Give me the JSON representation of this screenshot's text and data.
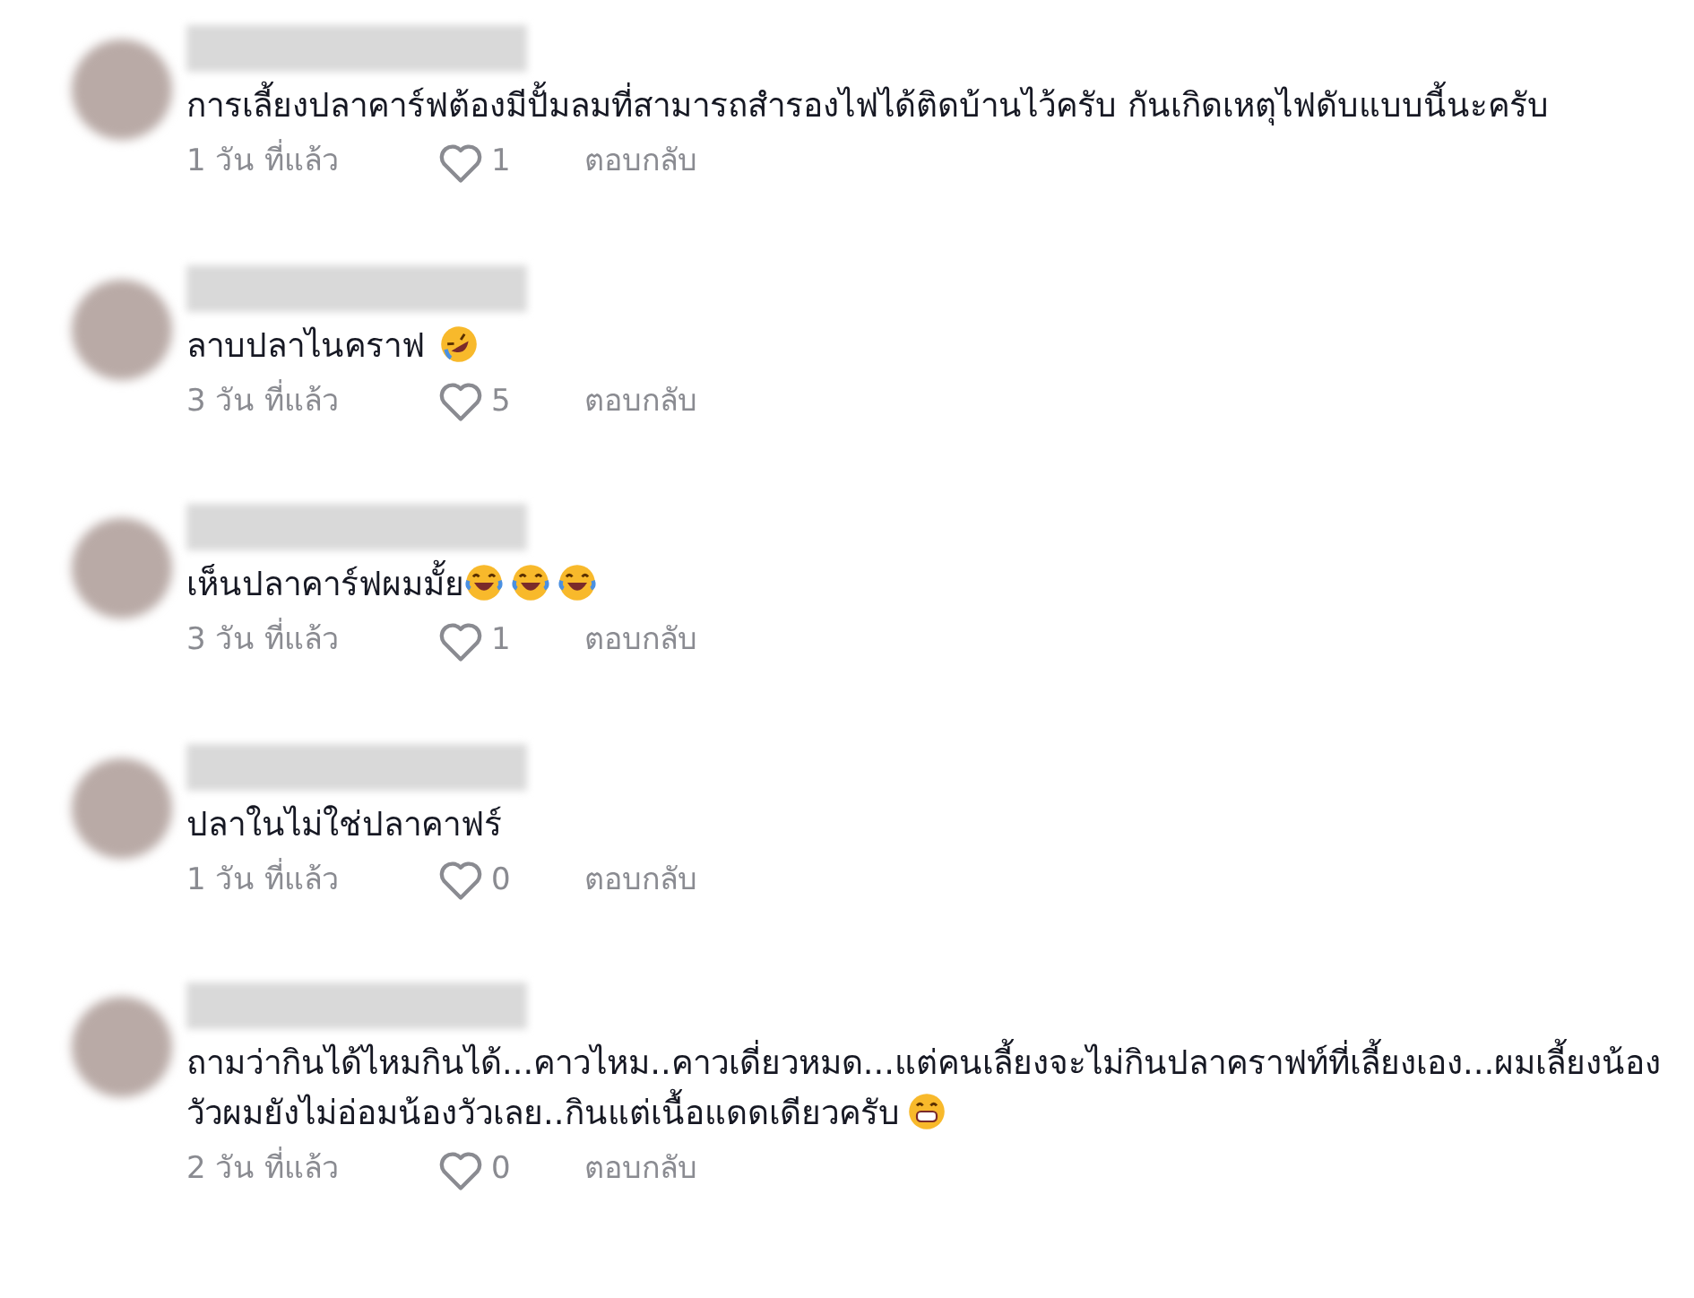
{
  "comments": [
    {
      "text": "การเลี้ยงปลาคาร์ฟต้องมีปั้มลมที่สามารถสำรองไฟได้ติดบ้านไว้ครับ กันเกิดเหตุไฟดับแบบนี้นะครับ",
      "time": "1 วัน ที่แล้ว",
      "likes": "1",
      "reply": "ตอบกลับ"
    },
    {
      "text": "ลาบปลาไนคราฟ",
      "emojis": [
        {
          "kind": "rolling"
        }
      ],
      "time": "3 วัน ที่แล้ว",
      "likes": "5",
      "reply": "ตอบกลับ"
    },
    {
      "text": "เห็นปลาคาร์ฟผมมั้ย",
      "emojis": [
        {
          "kind": "tears"
        },
        {
          "kind": "tears"
        },
        {
          "kind": "tears"
        }
      ],
      "time": "3 วัน ที่แล้ว",
      "likes": "1",
      "reply": "ตอบกลับ"
    },
    {
      "text": "ปลาในไม่ใช่ปลาคาฟร์",
      "time": "1 วัน ที่แล้ว",
      "likes": "0",
      "reply": "ตอบกลับ"
    },
    {
      "text": "ถามว่ากินได้ไหมกินได้...คาวไหม..คาวเดี่ยวหมด...แต่คนเลี้ยงจะไม่กินปลาคราฟท์ที่เลี้ยงเอง...ผมเลี้ยงน้องวัวผมยังไม่อ่อมน้องวัวเลย..กินแต่เนื้อแดดเดียวครับ",
      "emojis": [
        {
          "kind": "grin"
        }
      ],
      "time": "2 วัน ที่แล้ว",
      "likes": "0",
      "reply": "ตอบกลับ"
    }
  ]
}
